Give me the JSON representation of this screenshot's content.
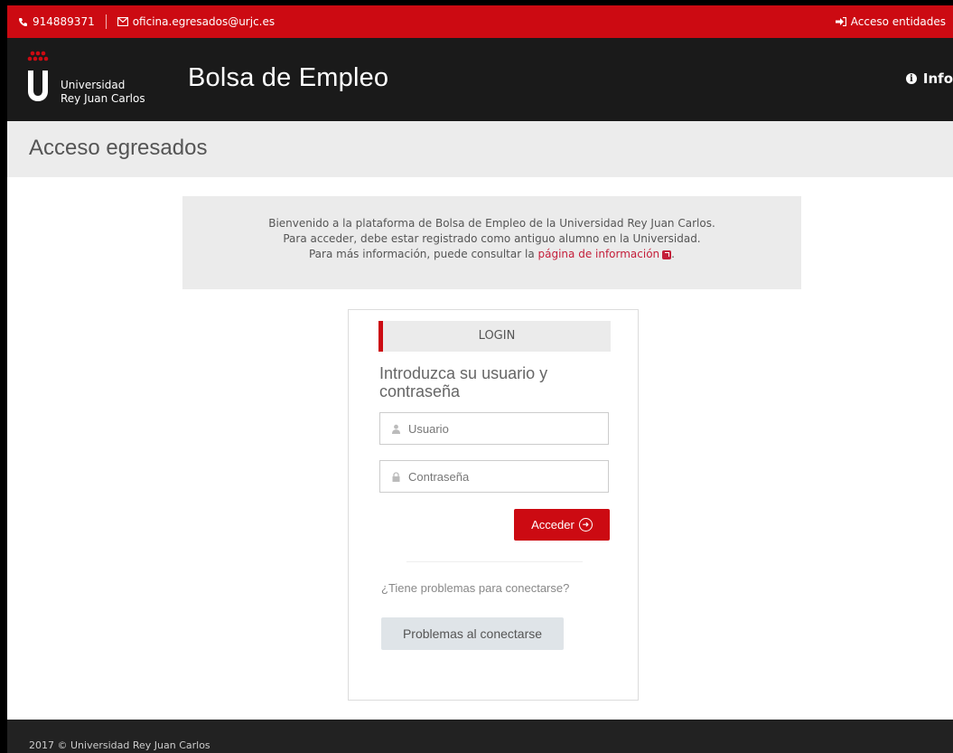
{
  "topbar": {
    "phone": "914889371",
    "email": "oficina.egresados@urjc.es",
    "entities_link": "Acceso entidades"
  },
  "header": {
    "university_line1": "Universidad",
    "university_line2": "Rey Juan Carlos",
    "title": "Bolsa de Empleo",
    "info_link": "Info"
  },
  "page": {
    "title": "Acceso egresados"
  },
  "welcome": {
    "line1": "Bienvenido a la plataforma de Bolsa de Empleo de la Universidad Rey Juan Carlos.",
    "line2": "Para acceder, debe estar registrado como antiguo alumno en la Universidad.",
    "line3_prefix": "Para más información, puede consultar la ",
    "line3_link": "página de información",
    "line3_suffix": "."
  },
  "login": {
    "tab_label": "LOGIN",
    "heading": "Introduzca su usuario y contraseña",
    "username_placeholder": "Usuario",
    "password_placeholder": "Contraseña",
    "submit_label": "Acceder",
    "problems_question": "¿Tiene problemas para conectarse?",
    "problems_button": "Problemas al conectarse"
  },
  "footer": {
    "text": "2017 © Universidad Rey Juan Carlos"
  },
  "colors": {
    "brand_red": "#cc0a12",
    "header_dark": "#1a1a1a",
    "link_red": "#c41e3a"
  }
}
